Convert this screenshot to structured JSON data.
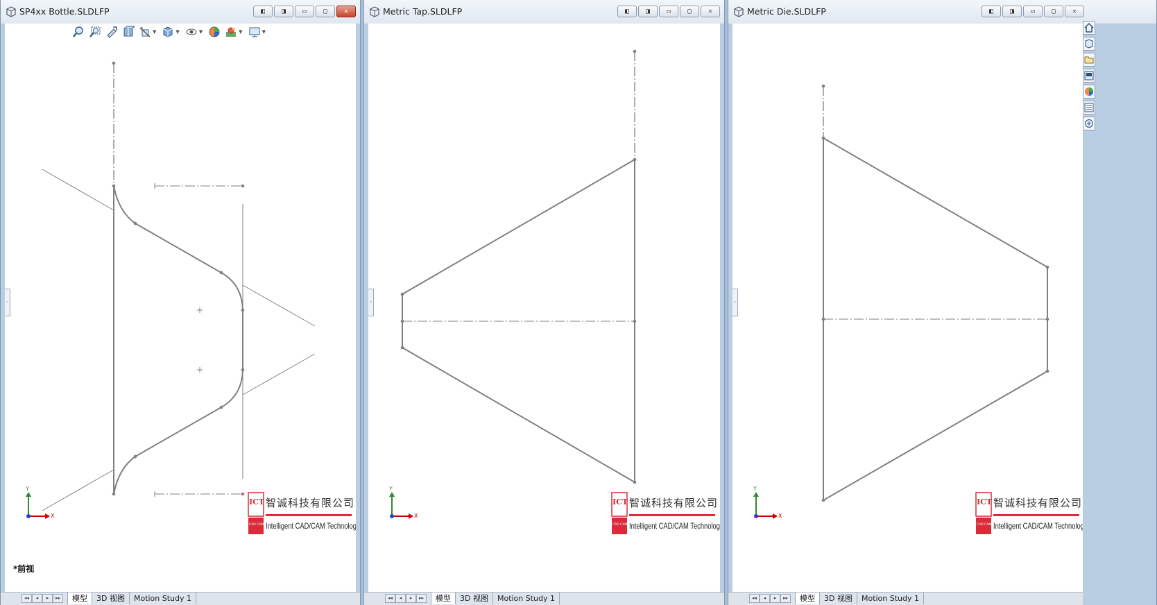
{
  "windows": [
    {
      "title": "SP4xx Bottle.SLDLFP",
      "close_style": "red"
    },
    {
      "title": "Metric Tap.SLDLFP",
      "close_style": "plain"
    },
    {
      "title": "Metric Die.SLDLFP",
      "close_style": "plain"
    }
  ],
  "window_controls": {
    "tile_left": "◧",
    "tile_right": "◨",
    "minimize": "▭",
    "restore": "▢",
    "close": "✕"
  },
  "view_label": "*前视",
  "tabs": [
    "模型",
    "3D 视图",
    "Motion Study 1"
  ],
  "tab_nav": [
    "◂◂",
    "◂",
    "▸",
    "▸▸"
  ],
  "triad": {
    "x_label": "X",
    "y_label": "Y"
  },
  "logo": {
    "mark": "ICT",
    "mark_sub": "CAD CAM",
    "chinese": "智诚科技有限公司",
    "english": "Intelligent CAD/CAM Technology Ltd."
  },
  "toolbar_icons": [
    "zoom-to-fit-icon",
    "zoom-area-icon",
    "previous-view-icon",
    "section-view-icon",
    "view-orientation-icon",
    "display-style-icon",
    "hide-show-icon",
    "edit-appearance-icon",
    "apply-scene-icon",
    "view-settings-icon"
  ],
  "taskpane_icons": [
    "home-icon",
    "design-library-icon",
    "file-explorer-icon",
    "view-palette-icon",
    "appearances-icon",
    "custom-properties-icon",
    "forum-icon"
  ],
  "colors": {
    "sketch_line": "#808080",
    "logo_red": "#d92b3a",
    "axis_x": "#cc0000",
    "axis_y": "#2d8a2d"
  }
}
